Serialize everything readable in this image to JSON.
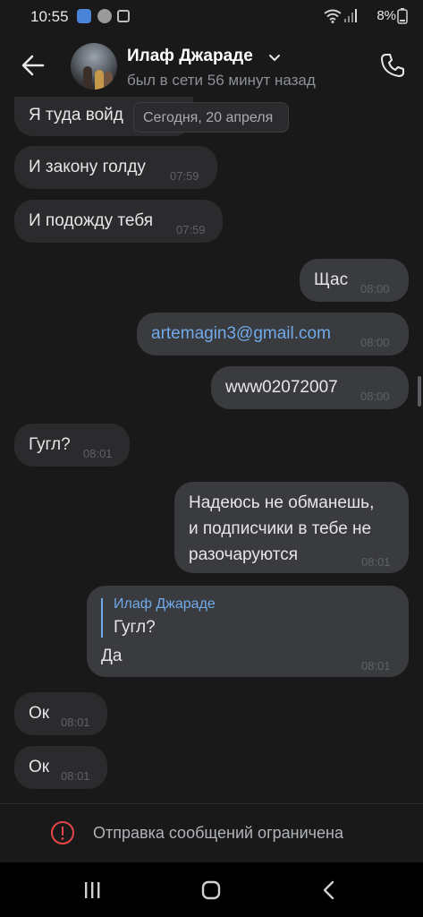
{
  "status_bar": {
    "time": "10:55",
    "battery": "8%"
  },
  "header": {
    "contact_name": "Илаф Джараде",
    "presence": "был в сети 56 минут назад"
  },
  "date_separator": "Сегодня, 20 апреля",
  "messages": [
    {
      "dir": "in",
      "text": "Я туда войд",
      "time": ""
    },
    {
      "dir": "in",
      "text": "И закону голду",
      "time": "07:59"
    },
    {
      "dir": "in",
      "text": "И подожду тебя",
      "time": "07:59"
    },
    {
      "dir": "out",
      "text": "Щас",
      "time": "08:00"
    },
    {
      "dir": "out",
      "text": "artemagin3@gmail.com",
      "time": "08:00"
    },
    {
      "dir": "out",
      "text": "www02072007",
      "time": "08:00"
    },
    {
      "dir": "in",
      "text": "Гугл?",
      "time": "08:01"
    },
    {
      "dir": "out",
      "lines": [
        "Надеюсь не обманешь,",
        "и подписчики в тебе не",
        "разочаруются"
      ],
      "time": "08:01"
    },
    {
      "dir": "out",
      "reply_to": {
        "author": "Илаф Джараде",
        "text": "Гугл?"
      },
      "text": "Да",
      "time": "08:01"
    },
    {
      "dir": "in",
      "text": "Ок",
      "time": "08:01"
    },
    {
      "dir": "in",
      "text": "Ок",
      "time": "08:01"
    }
  ],
  "footer": {
    "restricted_text": "Отправка сообщений ограничена"
  },
  "colors": {
    "background": "#19191a",
    "bubble_in": "#2b2b2d",
    "bubble_out": "#3a3b3e",
    "accent": "#71aaeb",
    "warning": "#e64646"
  },
  "icons": [
    "back-arrow-icon",
    "chevron-down-icon",
    "phone-icon",
    "warning-icon",
    "recent-apps-icon",
    "home-icon",
    "nav-back-icon"
  ]
}
